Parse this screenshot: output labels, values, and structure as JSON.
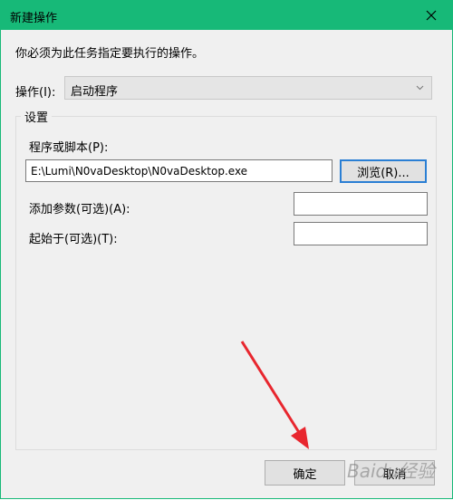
{
  "window": {
    "title": "新建操作"
  },
  "dialog": {
    "instruction": "你必须为此任务指定要执行的操作。",
    "action_label": "操作(I):",
    "action_value": "启动程序",
    "group_title": "设置",
    "program_label": "程序或脚本(P):",
    "program_value": "E:\\Lumi\\N0vaDesktop\\N0vaDesktop.exe",
    "browse_label": "浏览(R)...",
    "args_label": "添加参数(可选)(A):",
    "args_value": "",
    "start_label": "起始于(可选)(T):",
    "start_value": "",
    "ok_label": "确定",
    "cancel_label": "取消"
  },
  "watermark": "Baidu经验",
  "icons": {
    "close": "close-icon",
    "dropdown": "chevron-down-icon",
    "arrow": "red-arrow-annotation"
  },
  "colors": {
    "titlebar": "#17b978",
    "focus_border": "#2a7fd4",
    "arrow": "#e8262e"
  }
}
